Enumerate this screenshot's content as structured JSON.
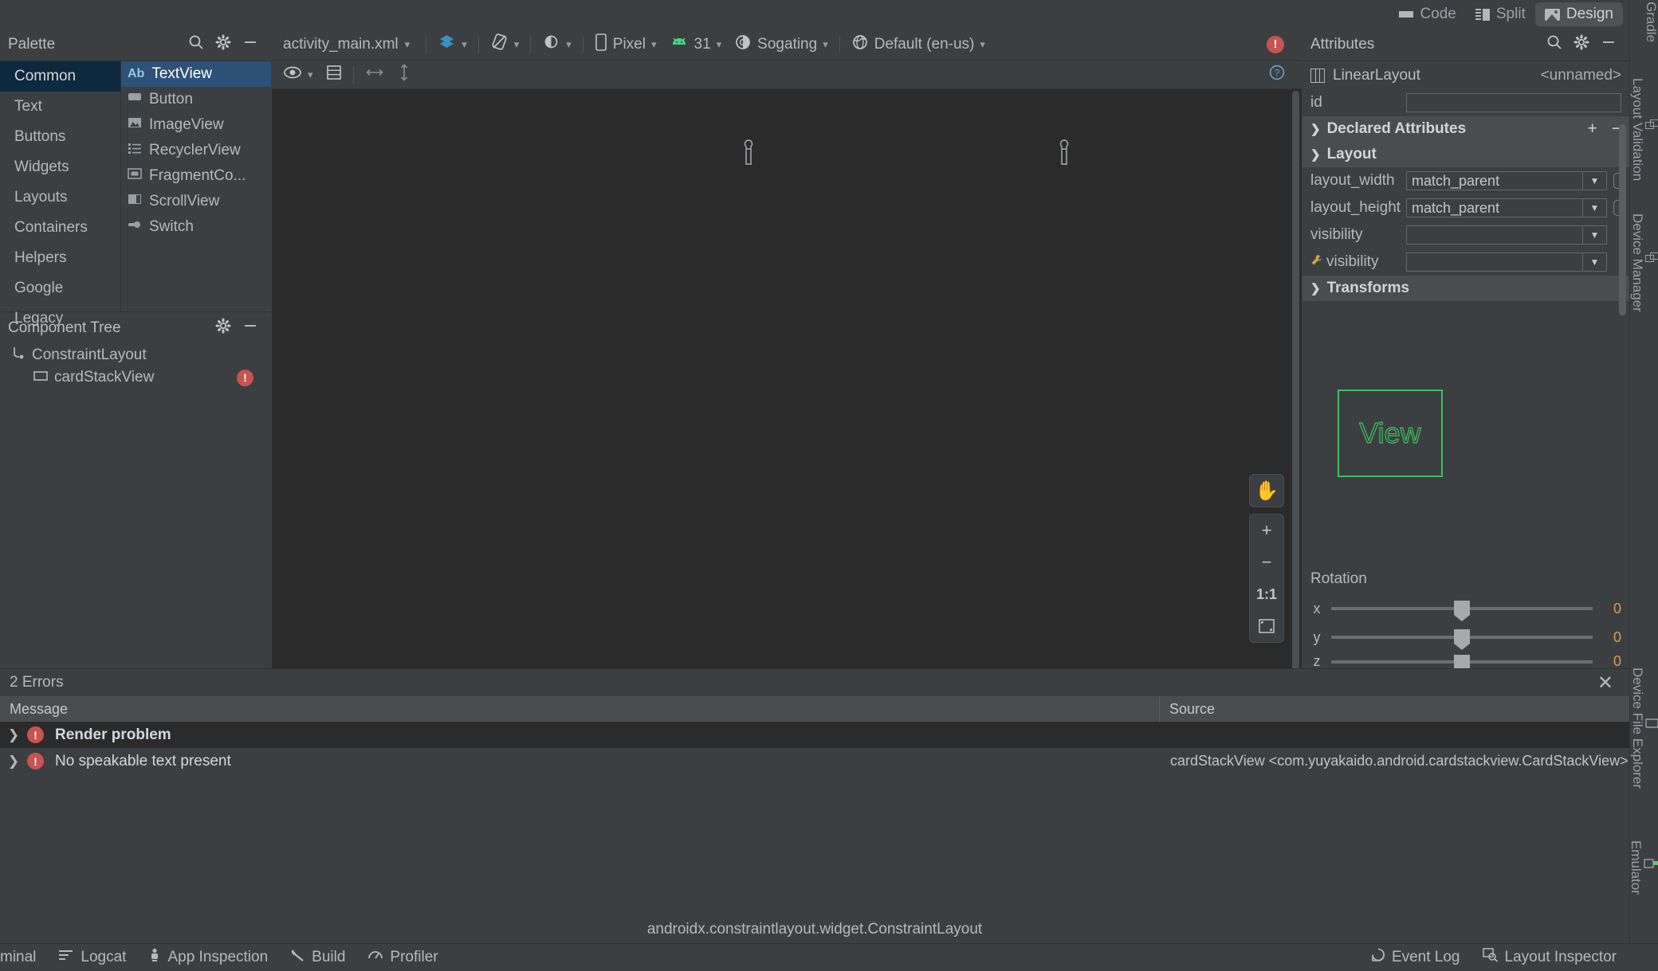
{
  "editor_modes": [
    {
      "label": "Code",
      "icon": "code-icon",
      "active": false
    },
    {
      "label": "Split",
      "icon": "split-icon",
      "active": false
    },
    {
      "label": "Design",
      "icon": "design-icon",
      "active": true
    }
  ],
  "right_strip": [
    {
      "label": "Gradle",
      "icon": "gradle-icon"
    },
    {
      "label": "Layout Validation",
      "icon": "layout-validation-icon"
    },
    {
      "label": "Device Manager",
      "icon": "device-manager-icon"
    },
    {
      "label": "Device File Explorer",
      "icon": "device-file-explorer-icon"
    },
    {
      "label": "Emulator",
      "icon": "emulator-icon"
    }
  ],
  "palette": {
    "title": "Palette",
    "search_icon": "search-icon",
    "settings_icon": "gear-icon",
    "minimize_icon": "minimize-icon",
    "categories": [
      {
        "label": "Common",
        "selected": true
      },
      {
        "label": "Text",
        "selected": false
      },
      {
        "label": "Buttons",
        "selected": false
      },
      {
        "label": "Widgets",
        "selected": false
      },
      {
        "label": "Layouts",
        "selected": false
      },
      {
        "label": "Containers",
        "selected": false
      },
      {
        "label": "Helpers",
        "selected": false
      },
      {
        "label": "Google",
        "selected": false
      },
      {
        "label": "Legacy",
        "selected": false
      }
    ],
    "items": [
      {
        "label": "TextView",
        "icon": "textview-icon",
        "selected": true
      },
      {
        "label": "Button",
        "icon": "button-icon",
        "selected": false
      },
      {
        "label": "ImageView",
        "icon": "imageview-icon",
        "selected": false
      },
      {
        "label": "RecyclerView",
        "icon": "recyclerview-icon",
        "selected": false
      },
      {
        "label": "FragmentCo...",
        "icon": "fragment-container-icon",
        "selected": false
      },
      {
        "label": "ScrollView",
        "icon": "scrollview-icon",
        "selected": false
      },
      {
        "label": "Switch",
        "icon": "switch-icon",
        "selected": false
      }
    ]
  },
  "component_tree": {
    "title": "Component Tree",
    "settings_icon": "gear-icon",
    "minimize_icon": "minimize-icon",
    "nodes": [
      {
        "label": "ConstraintLayout",
        "icon": "constraint-layout-icon",
        "error": false
      },
      {
        "label": "cardStackView",
        "icon": "view-icon",
        "error": true
      }
    ]
  },
  "editor_toolbar": {
    "file_name": "activity_main.xml",
    "design_surface_icon": "layers-icon",
    "orientation_icon": "rotate-icon",
    "theme_mode_icon": "night-mode-icon",
    "device": "Pixel",
    "device_icon": "phone-icon",
    "api_level": "31",
    "api_icon": "android-icon",
    "theme": "Sogating",
    "theme_icon": "theme-icon",
    "locale": "Default (en-us)",
    "locale_icon": "globe-icon",
    "error_badge": "!",
    "view_options_icon": "eye-icon",
    "blueprint_icon": "blueprint-icon",
    "horizontal_guide_icon": "horizontal-arrow-icon",
    "vertical_guide_icon": "vertical-arrow-icon",
    "help_icon": "help-icon"
  },
  "canvas": {
    "zoom_controls": [
      {
        "label": "",
        "icon": "pan-hand-icon"
      },
      {
        "label": "+",
        "icon": "zoom-in-icon"
      },
      {
        "label": "−",
        "icon": "zoom-out-icon"
      },
      {
        "label": "1:1",
        "icon": "zoom-actual-icon"
      },
      {
        "label": "",
        "icon": "zoom-to-fit-icon"
      }
    ]
  },
  "attributes": {
    "title": "Attributes",
    "search_icon": "search-icon",
    "settings_icon": "gear-icon",
    "minimize_icon": "minimize-icon",
    "component_type": "LinearLayout",
    "component_type_icon": "linearlayout-icon",
    "component_id_display": "<unnamed>",
    "id_label": "id",
    "id_value": "",
    "declared_attributes": {
      "label": "Declared Attributes",
      "add_icon": "plus-icon",
      "remove_icon": "minus-icon",
      "expand_icon": "chevron-right-icon"
    },
    "layout_section": {
      "label": "Layout",
      "expand_icon": "chevron-down-icon",
      "rows": [
        {
          "name": "layout_width",
          "value": "match_parent",
          "has_pin": true,
          "tool_attr": false
        },
        {
          "name": "layout_height",
          "value": "match_parent",
          "has_pin": true,
          "tool_attr": false
        },
        {
          "name": "visibility",
          "value": "",
          "has_pin": false,
          "tool_attr": false
        },
        {
          "name": "visibility",
          "value": "",
          "has_pin": false,
          "tool_attr": true
        }
      ]
    },
    "transforms_section": {
      "label": "Transforms",
      "expand_icon": "chevron-down-icon",
      "preview_label": "View",
      "preview_color": "#3fbf5f",
      "rotation_label": "Rotation",
      "rotation": [
        {
          "axis": "x",
          "value": "0",
          "position": 50
        },
        {
          "axis": "y",
          "value": "0",
          "position": 50
        },
        {
          "axis": "z",
          "value": "0",
          "position": 50
        }
      ]
    }
  },
  "errors_panel": {
    "title": "2 Errors",
    "close_icon": "close-icon",
    "columns": [
      "Message",
      "Source"
    ],
    "rows": [
      {
        "expand_icon": "chevron-right-icon",
        "severity_icon": "error-icon",
        "message": "Render problem",
        "source": "",
        "selected": true
      },
      {
        "expand_icon": "chevron-right-icon",
        "severity_icon": "error-icon",
        "message": "No speakable text present",
        "source": "cardStackView <com.yuyakaido.android.cardstackview.CardStackView>",
        "selected": false
      }
    ]
  },
  "status_path": "androidx.constraintlayout.widget.ConstraintLayout",
  "status_bar": {
    "left_items": [
      {
        "label": "minal",
        "icon": "terminal-icon"
      },
      {
        "label": "Logcat",
        "icon": "logcat-icon"
      },
      {
        "label": "App Inspection",
        "icon": "app-inspection-icon"
      },
      {
        "label": "Build",
        "icon": "build-icon"
      },
      {
        "label": "Profiler",
        "icon": "profiler-icon"
      }
    ],
    "right_items": [
      {
        "label": "Event Log",
        "icon": "event-log-icon"
      },
      {
        "label": "Layout Inspector",
        "icon": "layout-inspector-icon"
      }
    ]
  },
  "colors": {
    "bg": "#3c3f41",
    "canvas_bg": "#2b2b2b",
    "accent_blue": "#2d5177",
    "error_red": "#c75450",
    "green": "#3fbf5f"
  }
}
